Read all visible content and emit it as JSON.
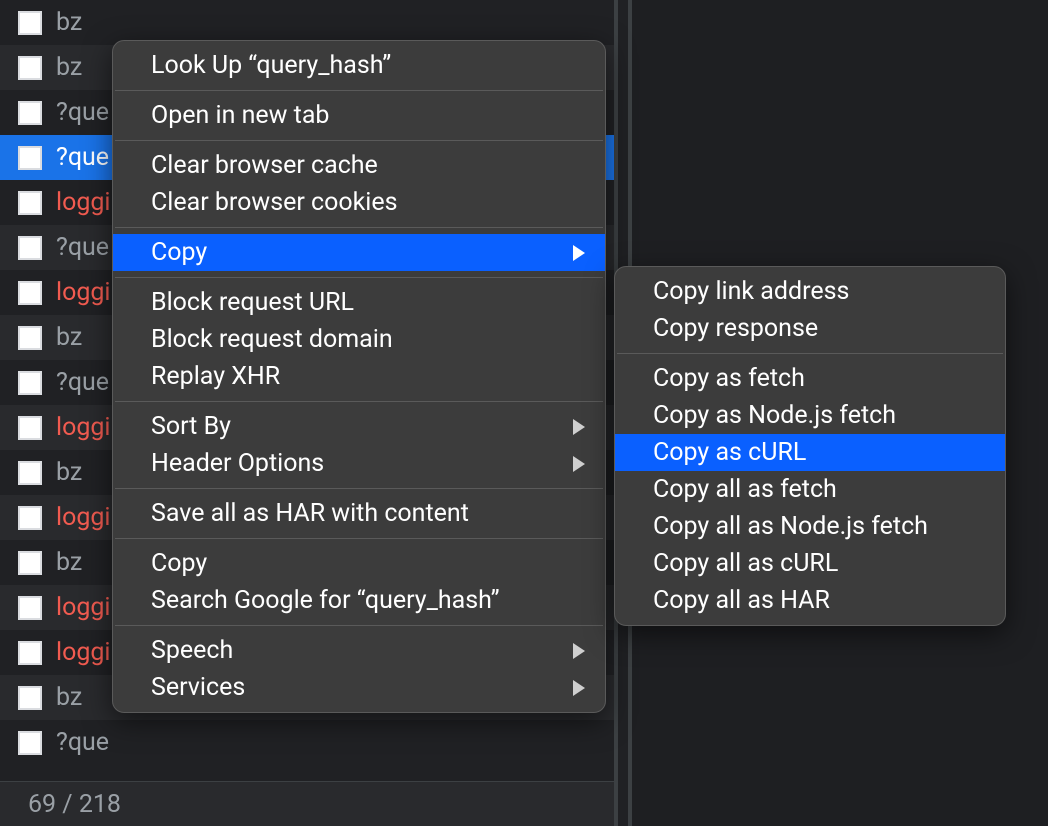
{
  "list": {
    "status": "69 / 218",
    "rows": [
      {
        "label": "bz",
        "cls": "gray",
        "alt": false,
        "selected": false
      },
      {
        "label": "bz",
        "cls": "gray",
        "alt": true,
        "selected": false
      },
      {
        "label": "?que",
        "cls": "gray",
        "alt": false,
        "selected": false
      },
      {
        "label": "?que",
        "cls": "gray",
        "alt": false,
        "selected": true
      },
      {
        "label": "loggi",
        "cls": "red",
        "alt": false,
        "selected": false
      },
      {
        "label": "?que",
        "cls": "gray",
        "alt": true,
        "selected": false
      },
      {
        "label": "loggi",
        "cls": "red",
        "alt": false,
        "selected": false
      },
      {
        "label": "bz",
        "cls": "gray",
        "alt": true,
        "selected": false
      },
      {
        "label": "?que",
        "cls": "gray",
        "alt": false,
        "selected": false
      },
      {
        "label": "loggi",
        "cls": "red",
        "alt": true,
        "selected": false
      },
      {
        "label": "bz",
        "cls": "gray",
        "alt": false,
        "selected": false
      },
      {
        "label": "loggi",
        "cls": "red",
        "alt": true,
        "selected": false
      },
      {
        "label": "bz",
        "cls": "gray",
        "alt": false,
        "selected": false
      },
      {
        "label": "loggi",
        "cls": "red",
        "alt": true,
        "selected": false
      },
      {
        "label": "loggi",
        "cls": "red",
        "alt": false,
        "selected": false
      },
      {
        "label": "bz",
        "cls": "gray",
        "alt": true,
        "selected": false
      },
      {
        "label": "?que",
        "cls": "gray",
        "alt": false,
        "selected": false
      }
    ]
  },
  "menu": {
    "groups": [
      [
        {
          "label": "Look Up “query_hash”",
          "submenu": false
        }
      ],
      [
        {
          "label": "Open in new tab",
          "submenu": false
        }
      ],
      [
        {
          "label": "Clear browser cache",
          "submenu": false
        },
        {
          "label": "Clear browser cookies",
          "submenu": false
        }
      ],
      [
        {
          "label": "Copy",
          "submenu": true,
          "highlight": true
        }
      ],
      [
        {
          "label": "Block request URL",
          "submenu": false
        },
        {
          "label": "Block request domain",
          "submenu": false
        },
        {
          "label": "Replay XHR",
          "submenu": false
        }
      ],
      [
        {
          "label": "Sort By",
          "submenu": true
        },
        {
          "label": "Header Options",
          "submenu": true
        }
      ],
      [
        {
          "label": "Save all as HAR with content",
          "submenu": false
        }
      ],
      [
        {
          "label": "Copy",
          "submenu": false
        },
        {
          "label": "Search Google for “query_hash”",
          "submenu": false
        }
      ],
      [
        {
          "label": "Speech",
          "submenu": true
        },
        {
          "label": "Services",
          "submenu": true
        }
      ]
    ]
  },
  "submenu": {
    "groups": [
      [
        {
          "label": "Copy link address"
        },
        {
          "label": "Copy response"
        }
      ],
      [
        {
          "label": "Copy as fetch"
        },
        {
          "label": "Copy as Node.js fetch"
        },
        {
          "label": "Copy as cURL",
          "highlight": true
        },
        {
          "label": "Copy all as fetch"
        },
        {
          "label": "Copy all as Node.js fetch"
        },
        {
          "label": "Copy all as cURL"
        },
        {
          "label": "Copy all as HAR"
        }
      ]
    ]
  }
}
